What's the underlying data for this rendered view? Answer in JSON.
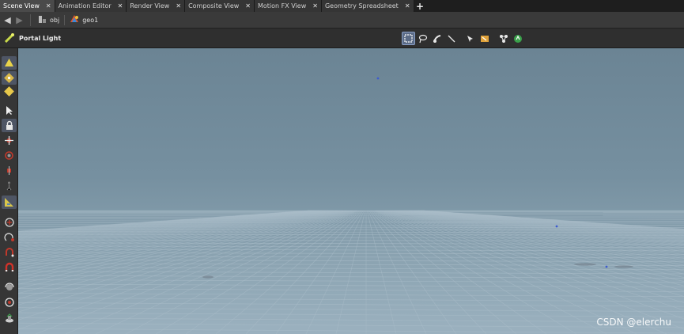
{
  "tabs": [
    {
      "label": "Scene View",
      "active": true
    },
    {
      "label": "Animation Editor",
      "active": false
    },
    {
      "label": "Render View",
      "active": false
    },
    {
      "label": "Composite View",
      "active": false
    },
    {
      "label": "Motion FX View",
      "active": false
    },
    {
      "label": "Geometry Spreadsheet",
      "active": false
    }
  ],
  "path": {
    "crumbs": [
      {
        "label": "obj",
        "icon": "obj-network-icon"
      },
      {
        "label": "geo1",
        "icon": "geo-node-icon"
      }
    ]
  },
  "operation": {
    "title": "Portal Light",
    "icon": "portal-light-icon",
    "tools": [
      "box-select-icon",
      "lasso-select-icon",
      "brush-select-icon",
      "laser-select-icon",
      "pick-visible-icon",
      "select-groups-icon",
      "select-connected-icon",
      "secure-selection-icon"
    ]
  },
  "left_toolbar": {
    "tools": [
      "object-mode-icon",
      "point-mode-icon",
      "primitive-mode-icon",
      "select-arrow-icon",
      "lock-icon",
      "move-icon",
      "rotate-icon",
      "scale-icon",
      "pose-icon",
      "handle-icon",
      "view-pan-icon",
      "snap-grid-icon",
      "snap-point-icon",
      "snap-magnet-icon",
      "tumble-icon",
      "camera-icon",
      "light-icon"
    ]
  },
  "viewport": {
    "background_top": "#6b8494",
    "background_bottom": "#9bb1bf",
    "grid_color": "#a9bcc8",
    "watermark": "CSDN @elerchu"
  }
}
